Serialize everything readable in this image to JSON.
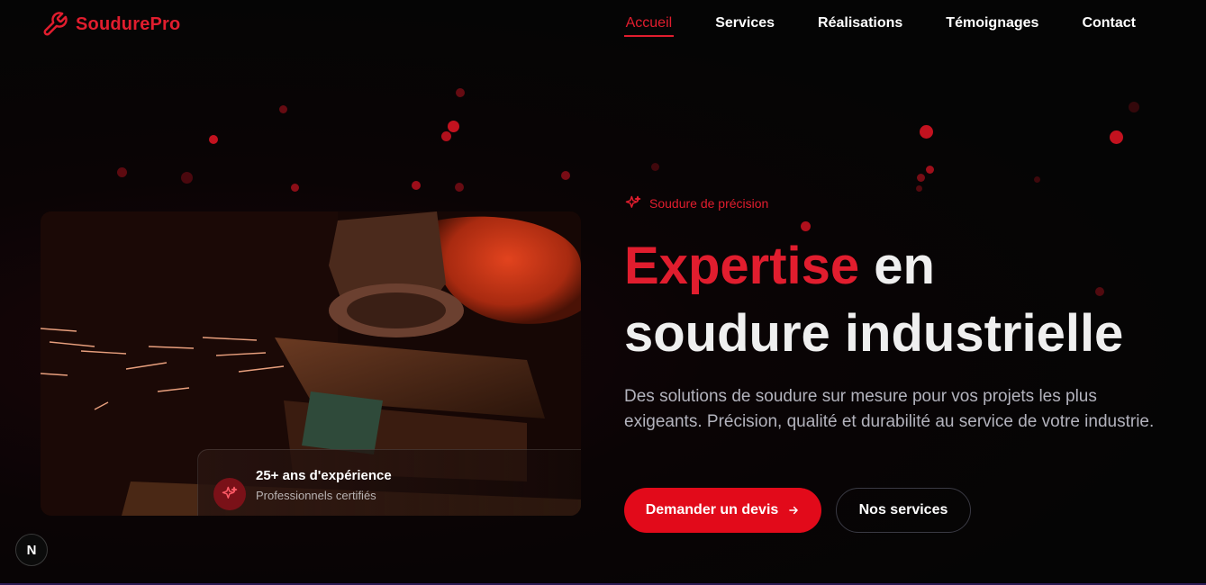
{
  "brand": {
    "name": "SoudurePro",
    "icon": "wrench-icon",
    "color": "#e11d2e"
  },
  "nav": {
    "items": [
      {
        "label": "Accueil",
        "active": true
      },
      {
        "label": "Services",
        "active": false
      },
      {
        "label": "Réalisations",
        "active": false
      },
      {
        "label": "Témoignages",
        "active": false
      },
      {
        "label": "Contact",
        "active": false
      }
    ]
  },
  "hero": {
    "eyebrow": {
      "icon": "sparkles-icon",
      "text": "Soudure de précision"
    },
    "headline_accent": "Expertise",
    "headline_rest_line1": " en",
    "headline_line2": "soudure industrielle",
    "description": "Des solutions de soudure sur mesure pour vos projets les plus exigeants. Précision, qualité et durabilité au service de votre industrie.",
    "primary_button": {
      "label": "Demander un devis",
      "icon": "arrow-right-icon"
    },
    "secondary_button": {
      "label": "Nos services"
    },
    "image": {
      "subject": "angle-grinder-sparks-photo"
    },
    "badge": {
      "icon": "sparkles-icon",
      "title": "25+ ans d'expérience",
      "subtitle": "Professionnels certifiés"
    }
  },
  "dev_badge": {
    "label": "N"
  },
  "colors": {
    "accent": "#e11d2e",
    "button": "#e20a1a",
    "background": "#050505",
    "text_muted": "#b3b3bd"
  }
}
